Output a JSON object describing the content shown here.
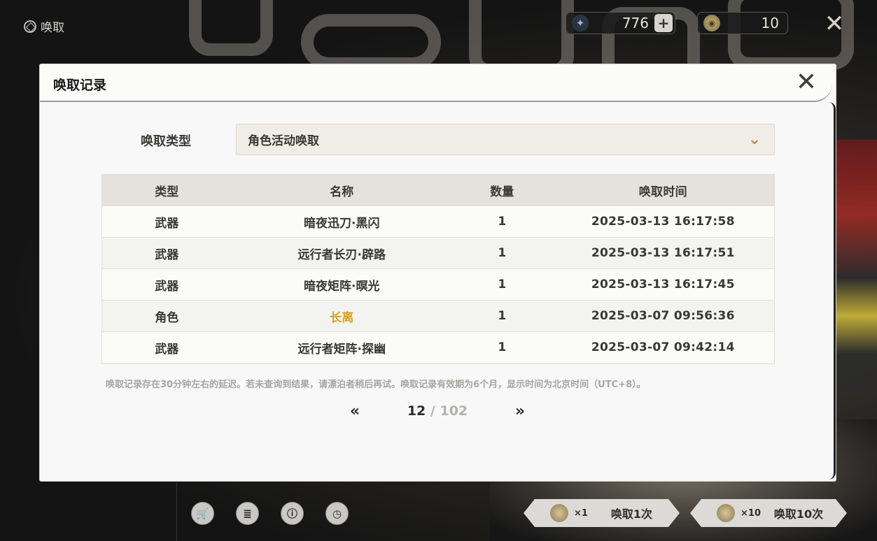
{
  "app": {
    "title": "唤取"
  },
  "currencies": [
    {
      "icon": "star-tide-icon",
      "value": "776"
    },
    {
      "icon": "coin-icon",
      "value": "10"
    }
  ],
  "dialog": {
    "title": "唤取记录",
    "filter": {
      "label": "唤取类型",
      "selected": "角色活动唤取"
    },
    "table": {
      "headers": [
        "类型",
        "名称",
        "数量",
        "唤取时间"
      ],
      "rows": [
        {
          "type": "武器",
          "name": "暗夜迅刀·黑闪",
          "qty": "1",
          "time": "2025-03-13 16:17:58",
          "highlight": false
        },
        {
          "type": "武器",
          "name": "远行者长刃·辟路",
          "qty": "1",
          "time": "2025-03-13 16:17:51",
          "highlight": false
        },
        {
          "type": "武器",
          "name": "暗夜矩阵·暝光",
          "qty": "1",
          "time": "2025-03-13 16:17:45",
          "highlight": false
        },
        {
          "type": "角色",
          "name": "长离",
          "qty": "1",
          "time": "2025-03-07 09:56:36",
          "highlight": true
        },
        {
          "type": "武器",
          "name": "远行者矩阵·探幽",
          "qty": "1",
          "time": "2025-03-07 09:42:14",
          "highlight": false
        }
      ],
      "highlight_color": "#d7a418"
    },
    "note": "唤取记录存在30分钟左右的延迟。若未查询到结果，请漂泊者稍后再试。唤取记录有效期为6个月，显示时间为北京时间（UTC+8）。",
    "pager": {
      "current": "12",
      "separator": "/",
      "total": "102"
    }
  },
  "bottom": {
    "pull_one": {
      "mult": "×1",
      "label": "唤取1次"
    },
    "pull_ten": {
      "mult": "×10",
      "label": "唤取10次"
    }
  }
}
